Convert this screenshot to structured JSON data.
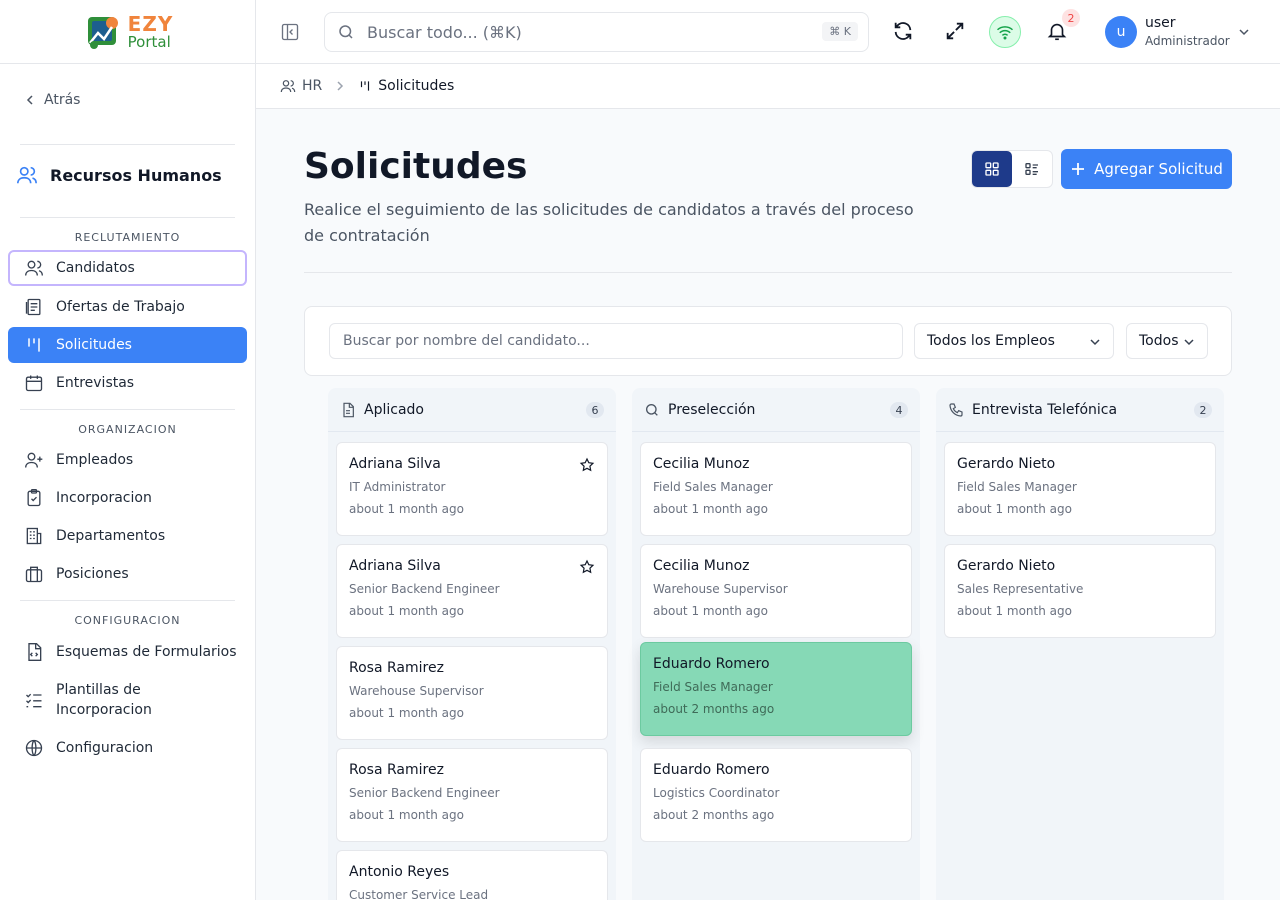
{
  "brand": {
    "top": "EZY",
    "bottom": "Portal"
  },
  "sidebar": {
    "back_label": "Atrás",
    "section_title": "Recursos Humanos",
    "groups": [
      {
        "label": "RECLUTAMIENTO"
      },
      {
        "label": "ORGANIZACION"
      },
      {
        "label": "CONFIGURACION"
      }
    ],
    "items": [
      {
        "label": "Candidatos",
        "icon": "users-icon"
      },
      {
        "label": "Ofertas de Trabajo",
        "icon": "job-list-icon"
      },
      {
        "label": "Solicitudes",
        "icon": "kanban-icon"
      },
      {
        "label": "Entrevistas",
        "icon": "calendar-icon"
      },
      {
        "label": "Empleados",
        "icon": "user-plus-icon"
      },
      {
        "label": "Incorporacion",
        "icon": "clipboard-check-icon"
      },
      {
        "label": "Departamentos",
        "icon": "building-icon"
      },
      {
        "label": "Posiciones",
        "icon": "briefcase-icon"
      },
      {
        "label": "Esquemas de Formularios",
        "icon": "file-code-icon"
      },
      {
        "label_line1": "Plantillas de",
        "label_line2": "Incorporacion",
        "icon": "list-check-icon"
      },
      {
        "label": "Configuracion",
        "icon": "globe-icon"
      }
    ]
  },
  "topbar": {
    "search_placeholder": "Buscar todo... (⌘K)",
    "shortcut": "⌘ K",
    "notification_count": "2",
    "user_initial": "u",
    "user_name": "user",
    "user_role": "Administrador"
  },
  "breadcrumb": {
    "parent": "HR",
    "current": "Solicitudes"
  },
  "page": {
    "title": "Solicitudes",
    "description": "Realice el seguimiento de las solicitudes de candidatos a través del proceso de contratación",
    "add_button": "Agregar Solicitud"
  },
  "filters": {
    "search_placeholder": "Buscar por nombre del candidato...",
    "jobs_select": "Todos los Empleos",
    "status_select": "Todos"
  },
  "columns": [
    {
      "title": "Aplicado",
      "count": "6",
      "icon": "file-text-icon",
      "cards": [
        {
          "name": "Adriana Silva",
          "role": "IT Administrator",
          "time": "about 1 month ago",
          "starred": true
        },
        {
          "name": "Adriana Silva",
          "role": "Senior Backend Engineer",
          "time": "about 1 month ago",
          "starred": true
        },
        {
          "name": "Rosa Ramirez",
          "role": "Warehouse Supervisor",
          "time": "about 1 month ago"
        },
        {
          "name": "Rosa Ramirez",
          "role": "Senior Backend Engineer",
          "time": "about 1 month ago"
        },
        {
          "name": "Antonio Reyes",
          "role": "Customer Service Lead",
          "time": ""
        }
      ]
    },
    {
      "title": "Preselección",
      "count": "4",
      "icon": "search-icon",
      "cards": [
        {
          "name": "Cecilia Munoz",
          "role": "Field Sales Manager",
          "time": "about 1 month ago"
        },
        {
          "name": "Cecilia Munoz",
          "role": "Warehouse Supervisor",
          "time": "about 1 month ago"
        },
        {
          "name": "Eduardo Romero",
          "role": "Field Sales Manager",
          "time": "about 2 months ago",
          "highlight": "#86d9b6"
        },
        {
          "name": "Eduardo Romero",
          "role": "Logistics Coordinator",
          "time": "about 2 months ago"
        }
      ]
    },
    {
      "title": "Entrevista Telefónica",
      "count": "2",
      "icon": "phone-icon",
      "cards": [
        {
          "name": "Gerardo Nieto",
          "role": "Field Sales Manager",
          "time": "about 1 month ago"
        },
        {
          "name": "Gerardo Nieto",
          "role": "Sales Representative",
          "time": "about 1 month ago"
        }
      ]
    }
  ],
  "colors": {
    "accent": "#3b82f6",
    "active_view": "#1e3a8a",
    "brand_orange": "#f0843c",
    "brand_green": "#2f8f3a"
  }
}
